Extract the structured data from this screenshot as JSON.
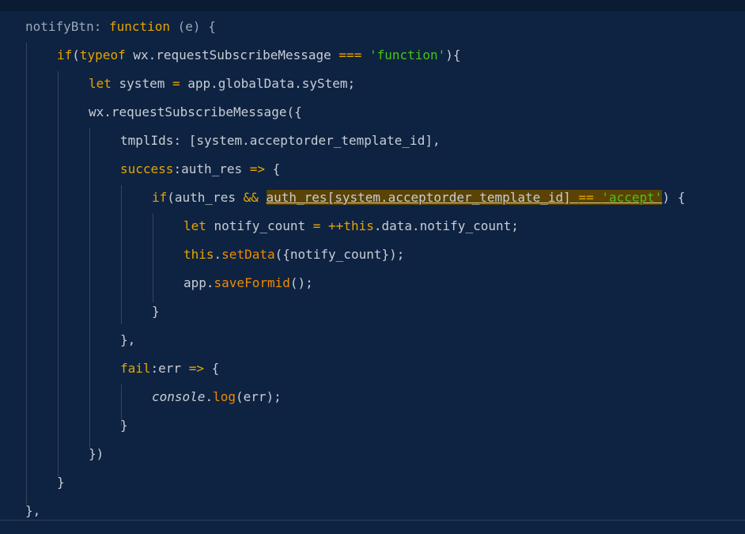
{
  "colors": {
    "background": "#0e2341",
    "plain": "#c8cdd6",
    "keyword": "#e6a400",
    "string": "#46c31a",
    "method": "#f08a00",
    "highlight": "#5a4305",
    "guide": "#33465f"
  },
  "code": {
    "lines": [
      {
        "indent": 0,
        "tokens": [
          {
            "t": "notifyBtn",
            "c": "#9aa7b8"
          },
          {
            "t": ": ",
            "c": "#9aa7b8"
          },
          {
            "t": "function",
            "c": "#e6a400"
          },
          {
            "t": " (e) {",
            "c": "#9aa7b8"
          }
        ]
      },
      {
        "indent": 1,
        "tokens": [
          {
            "t": "if",
            "c": "#e6a400"
          },
          {
            "t": "(",
            "c": "#c8cdd6"
          },
          {
            "t": "typeof",
            "c": "#e6a400"
          },
          {
            "t": " wx.requestSubscribeMessage ",
            "c": "#c8cdd6"
          },
          {
            "t": "===",
            "c": "#e6a400"
          },
          {
            "t": " ",
            "c": "#c8cdd6"
          },
          {
            "t": "'function'",
            "c": "#46c31a"
          },
          {
            "t": "){",
            "c": "#c8cdd6"
          }
        ]
      },
      {
        "indent": 2,
        "tokens": [
          {
            "t": "let",
            "c": "#e6a400"
          },
          {
            "t": " system ",
            "c": "#c8cdd6"
          },
          {
            "t": "=",
            "c": "#e6a400"
          },
          {
            "t": " app.globalData.syStem;",
            "c": "#c8cdd6"
          }
        ]
      },
      {
        "indent": 2,
        "tokens": [
          {
            "t": "wx.requestSubscribeMessage({",
            "c": "#c8cdd6"
          }
        ]
      },
      {
        "indent": 3,
        "tokens": [
          {
            "t": "tmplIds",
            "c": "#c8cdd6"
          },
          {
            "t": ": [system.acceptorder_template_id],",
            "c": "#c8cdd6"
          }
        ]
      },
      {
        "indent": 3,
        "tokens": [
          {
            "t": "success",
            "c": "#e6a400"
          },
          {
            "t": ":auth_res ",
            "c": "#c8cdd6"
          },
          {
            "t": "=>",
            "c": "#e6a400"
          },
          {
            "t": " {",
            "c": "#c8cdd6"
          }
        ]
      },
      {
        "indent": 4,
        "tokens": [
          {
            "t": "if",
            "c": "#e6a400"
          },
          {
            "t": "(auth_res ",
            "c": "#c8cdd6"
          },
          {
            "t": "&&",
            "c": "#e6a400"
          },
          {
            "t": " ",
            "c": "#c8cdd6"
          },
          {
            "t": "auth_res[system.acceptorder_template_id] ",
            "c": "#c8cdd6",
            "hl": true
          },
          {
            "t": "==",
            "c": "#e6a400",
            "hl": true
          },
          {
            "t": " ",
            "c": "#c8cdd6",
            "hl": true
          },
          {
            "t": "'accept'",
            "c": "#46c31a",
            "hl": true
          },
          {
            "t": ") {",
            "c": "#c8cdd6"
          }
        ]
      },
      {
        "indent": 5,
        "tokens": [
          {
            "t": "let",
            "c": "#e6a400"
          },
          {
            "t": " notify_count ",
            "c": "#c8cdd6"
          },
          {
            "t": "=",
            "c": "#e6a400"
          },
          {
            "t": " ",
            "c": "#c8cdd6"
          },
          {
            "t": "++",
            "c": "#e6a400"
          },
          {
            "t": "this",
            "c": "#e6a400"
          },
          {
            "t": ".data.notify_count;",
            "c": "#c8cdd6"
          }
        ]
      },
      {
        "indent": 5,
        "tokens": [
          {
            "t": "this",
            "c": "#e6a400"
          },
          {
            "t": ".",
            "c": "#c8cdd6"
          },
          {
            "t": "setData",
            "c": "#f08a00"
          },
          {
            "t": "({notify_count});",
            "c": "#c8cdd6"
          }
        ]
      },
      {
        "indent": 5,
        "tokens": [
          {
            "t": "app.",
            "c": "#c8cdd6"
          },
          {
            "t": "saveFormid",
            "c": "#f08a00"
          },
          {
            "t": "();",
            "c": "#c8cdd6"
          }
        ]
      },
      {
        "indent": 4,
        "tokens": [
          {
            "t": "}",
            "c": "#c8cdd6"
          }
        ]
      },
      {
        "indent": 3,
        "tokens": [
          {
            "t": "},",
            "c": "#c8cdd6"
          }
        ]
      },
      {
        "indent": 3,
        "tokens": [
          {
            "t": "fail",
            "c": "#e6a400"
          },
          {
            "t": ":err ",
            "c": "#c8cdd6"
          },
          {
            "t": "=>",
            "c": "#e6a400"
          },
          {
            "t": " {",
            "c": "#c8cdd6"
          }
        ]
      },
      {
        "indent": 4,
        "tokens": [
          {
            "t": "console",
            "c": "#c8cdd6",
            "italic": true
          },
          {
            "t": ".",
            "c": "#c8cdd6"
          },
          {
            "t": "log",
            "c": "#f08a00"
          },
          {
            "t": "(err);",
            "c": "#c8cdd6"
          }
        ]
      },
      {
        "indent": 3,
        "tokens": [
          {
            "t": "}",
            "c": "#c8cdd6"
          }
        ]
      },
      {
        "indent": 2,
        "tokens": [
          {
            "t": "})",
            "c": "#c8cdd6"
          }
        ]
      },
      {
        "indent": 1,
        "tokens": [
          {
            "t": "}",
            "c": "#c8cdd6"
          }
        ]
      },
      {
        "indent": 0,
        "tokens": [
          {
            "t": "},",
            "c": "#c8cdd6"
          }
        ]
      }
    ]
  }
}
